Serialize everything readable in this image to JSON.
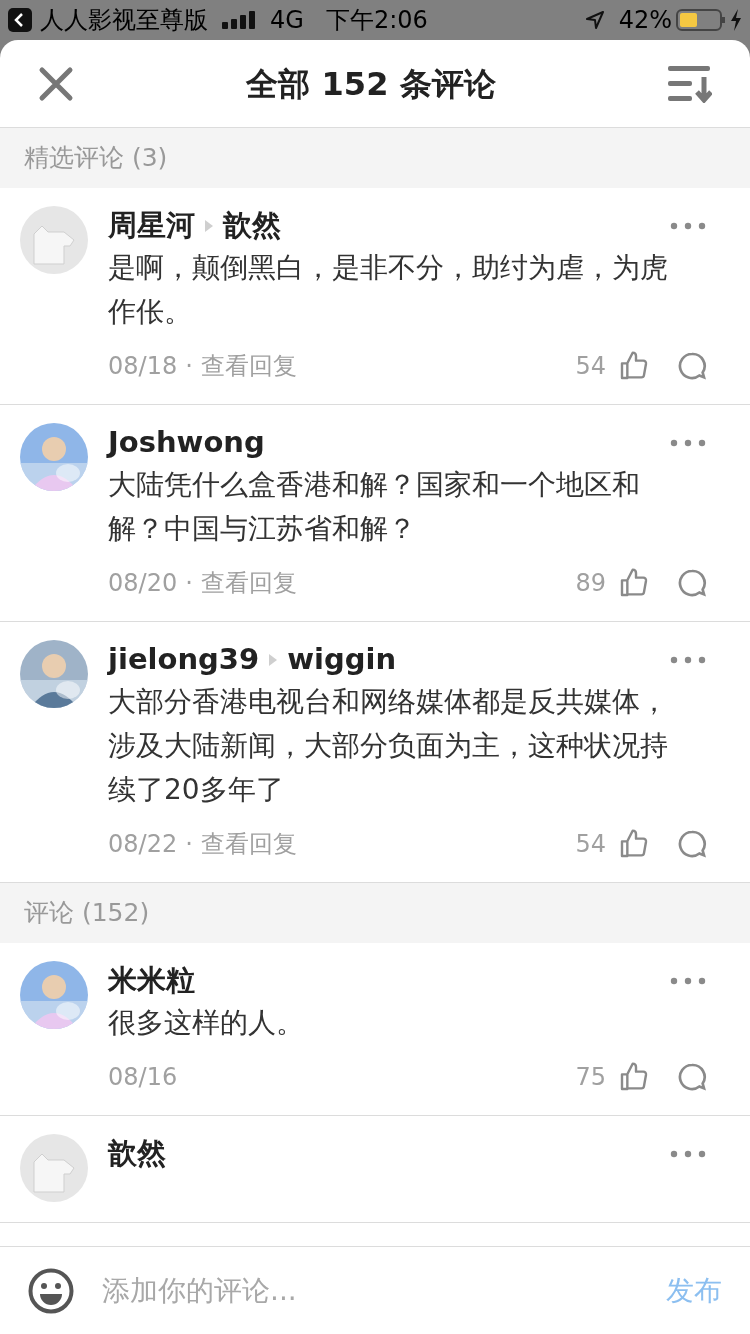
{
  "status_bar": {
    "back_app": "人人影视至尊版",
    "network": "4G",
    "time": "下午2:06",
    "battery": "42%"
  },
  "header": {
    "title": "全部 152 条评论"
  },
  "sections": [
    {
      "title": "精选评论 (3)",
      "comments": [
        {
          "avatar": {
            "kind": "placeholder"
          },
          "name": "周星河",
          "reply_to": "歆然",
          "text": "是啊，颠倒黑白，是非不分，助纣为虐，为虎作伥。",
          "date": "08/18",
          "separator": "·",
          "replies_link": "查看回复",
          "likes": "54"
        },
        {
          "name": "Joshwong",
          "text": "大陆凭什么盒香港和解？国家和一个地区和解？中国与江苏省和解？",
          "date": "08/20",
          "separator": "·",
          "replies_link": "查看回复",
          "likes": "89"
        },
        {
          "name": "jielong39",
          "reply_to": "wiggin",
          "text": "大部分香港电视台和网络媒体都是反共媒体，涉及大陆新闻，大部分负面为主，这种状况持续了20多年了",
          "date": "08/22",
          "separator": "·",
          "replies_link": "查看回复",
          "likes": "54"
        }
      ]
    },
    {
      "title": "评论 (152)",
      "comments": [
        {
          "name": "米米粒",
          "text": "很多这样的人。",
          "date": "08/16",
          "likes": "75"
        },
        {
          "avatar": {
            "kind": "placeholder"
          },
          "name": "歆然"
        }
      ]
    }
  ],
  "composer": {
    "placeholder": "添加你的评论...",
    "submit": "发布"
  }
}
